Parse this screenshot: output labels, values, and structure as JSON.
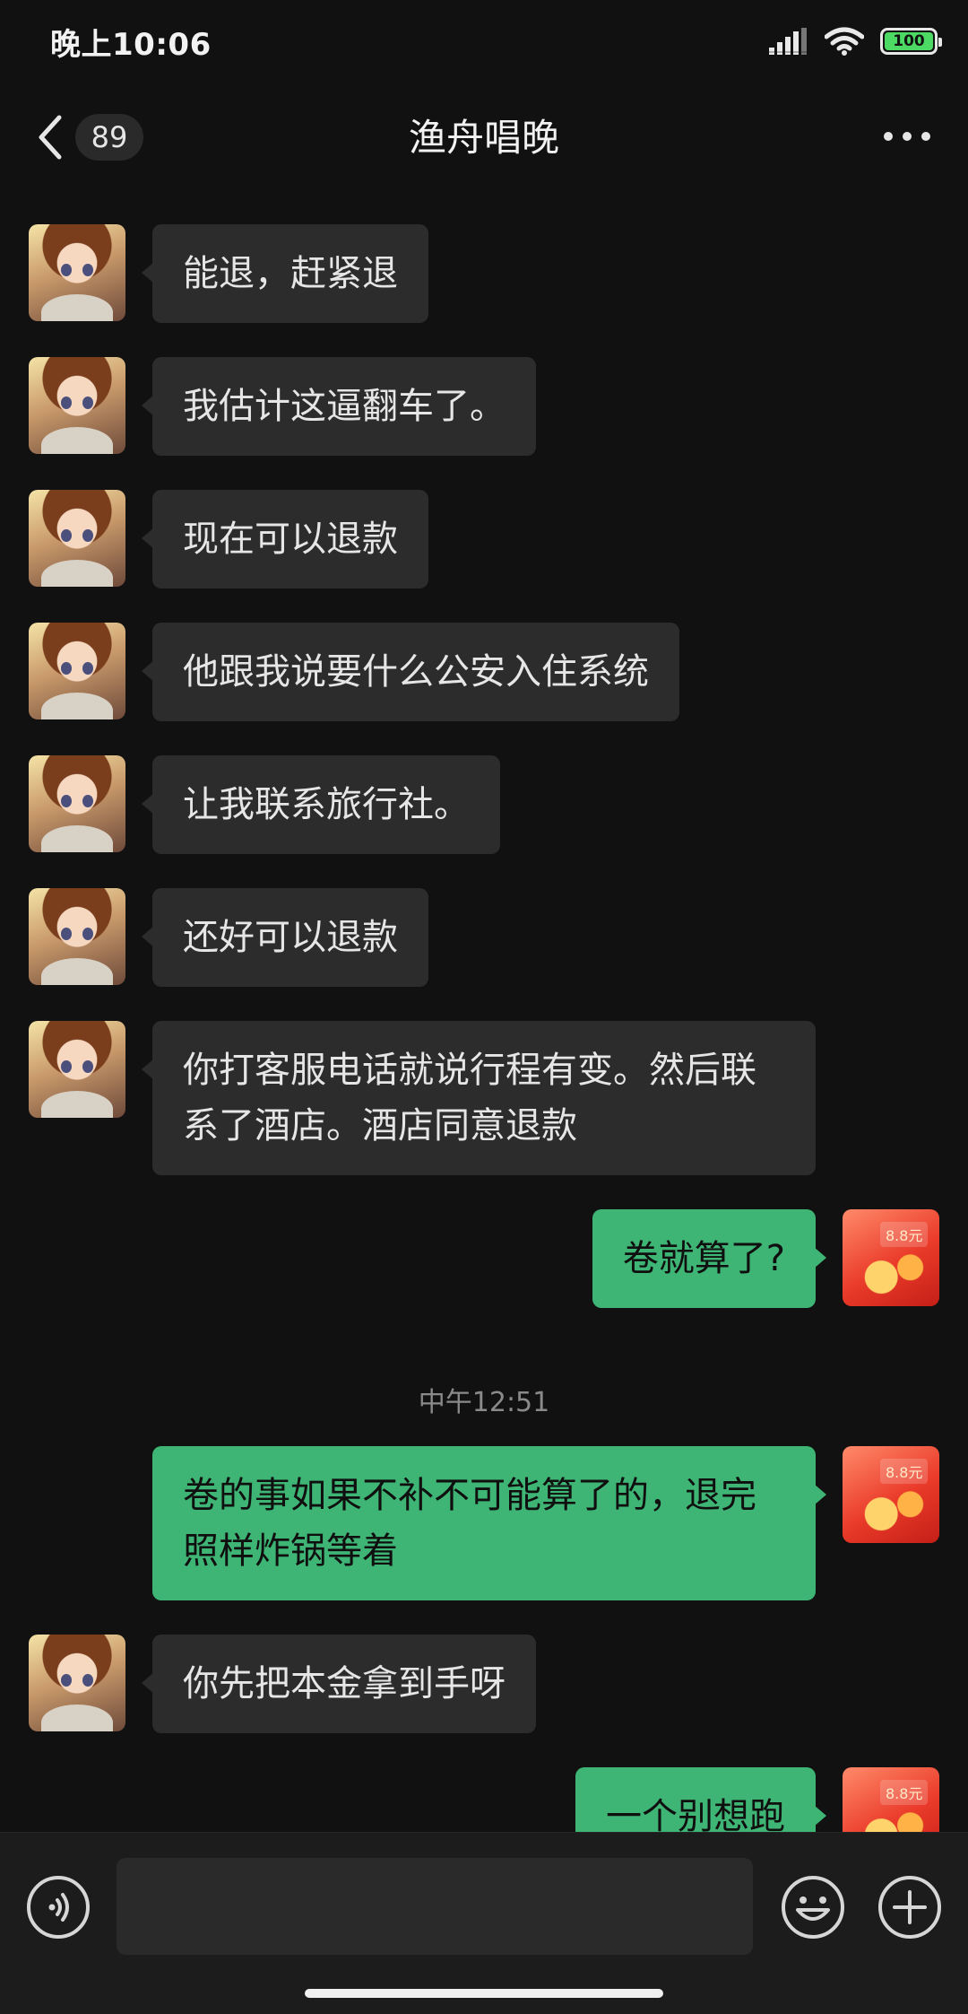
{
  "status_bar": {
    "time": "晚上10:06",
    "battery": "100",
    "icons": [
      "signal-icon",
      "wifi-icon",
      "battery-icon"
    ]
  },
  "header": {
    "unread_count": "89",
    "title": "渔舟唱晚",
    "back_icon": "chevron-left-icon",
    "more_icon": "more-dots-icon"
  },
  "messages": [
    {
      "side": "left",
      "text": "能退，赶紧退"
    },
    {
      "side": "left",
      "text": "我估计这逼翻车了。"
    },
    {
      "side": "left",
      "text": "现在可以退款"
    },
    {
      "side": "left",
      "text": "他跟我说要什么公安入住系统"
    },
    {
      "side": "left",
      "text": "让我联系旅行社。"
    },
    {
      "side": "left",
      "text": "还好可以退款"
    },
    {
      "side": "left",
      "text": "你打客服电话就说行程有变。然后联系了酒店。酒店同意退款"
    },
    {
      "side": "right",
      "text": "卷就算了?"
    },
    {
      "side": "right",
      "text": "卷的事如果不补不可能算了的，退完照样炸锅等着"
    },
    {
      "side": "left",
      "text": "你先把本金拿到手呀"
    },
    {
      "side": "right",
      "text": "一个别想跑"
    }
  ],
  "timestamp": "中午12:51",
  "my_avatar_label": "8.8元",
  "input": {
    "value": "",
    "placeholder": ""
  },
  "colors": {
    "background": "#111111",
    "received_bubble": "#2c2c2c",
    "sent_bubble": "#3eb575"
  }
}
